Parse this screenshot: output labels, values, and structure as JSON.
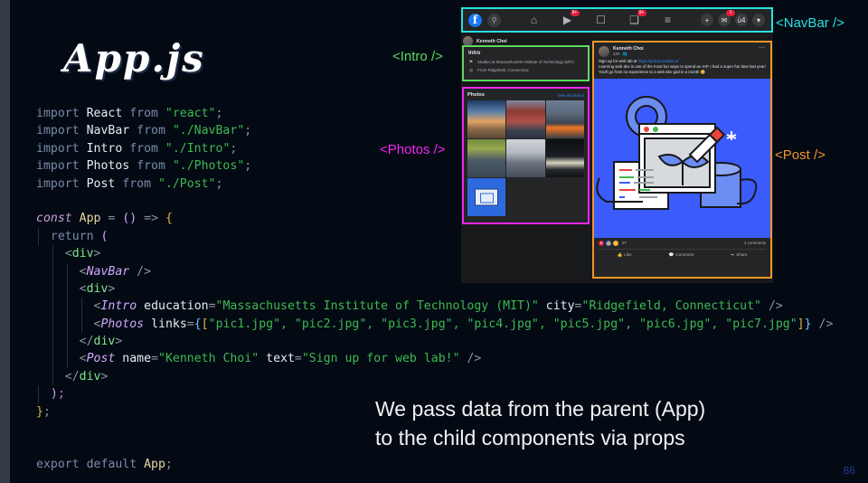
{
  "slide": {
    "title": "App.js",
    "caption_line1": "We pass data from the parent (App)",
    "caption_line2": "to the child components via props",
    "page_number": "86"
  },
  "annotations": {
    "navbar": {
      "label": "<NavBar />",
      "color": "#2ae0e0"
    },
    "intro": {
      "label": "<Intro />",
      "color": "#5cdb5c"
    },
    "photos": {
      "label": "<Photos />",
      "color": "#f026f0"
    },
    "post": {
      "label": "<Post />",
      "color": "#f2952b"
    }
  },
  "code": {
    "lines": [
      {
        "id": "l1",
        "tokens": [
          {
            "t": "import ",
            "c": "kw"
          },
          {
            "t": "React",
            "c": "id"
          },
          {
            "t": " from ",
            "c": "kw"
          },
          {
            "t": "\"react\"",
            "c": "str"
          },
          {
            "t": ";",
            "c": "punc"
          }
        ]
      },
      {
        "id": "l2",
        "tokens": [
          {
            "t": "import ",
            "c": "kw"
          },
          {
            "t": "NavBar",
            "c": "id"
          },
          {
            "t": " from ",
            "c": "kw"
          },
          {
            "t": "\"./NavBar\"",
            "c": "str"
          },
          {
            "t": ";",
            "c": "punc"
          }
        ]
      },
      {
        "id": "l3",
        "tokens": [
          {
            "t": "import ",
            "c": "kw"
          },
          {
            "t": "Intro",
            "c": "id"
          },
          {
            "t": " from ",
            "c": "kw"
          },
          {
            "t": "\"./Intro\"",
            "c": "str"
          },
          {
            "t": ";",
            "c": "punc"
          }
        ]
      },
      {
        "id": "l4",
        "tokens": [
          {
            "t": "import ",
            "c": "kw"
          },
          {
            "t": "Photos",
            "c": "id"
          },
          {
            "t": " from ",
            "c": "kw"
          },
          {
            "t": "\"./Photos\"",
            "c": "str"
          },
          {
            "t": ";",
            "c": "punc"
          }
        ]
      },
      {
        "id": "l5",
        "tokens": [
          {
            "t": "import ",
            "c": "kw"
          },
          {
            "t": "Post",
            "c": "id"
          },
          {
            "t": " from ",
            "c": "kw"
          },
          {
            "t": "\"./Post\"",
            "c": "str"
          },
          {
            "t": ";",
            "c": "punc"
          }
        ]
      },
      {
        "id": "l6",
        "tokens": []
      },
      {
        "id": "l7",
        "tokens": [
          {
            "t": "const ",
            "c": "constkw"
          },
          {
            "t": "App",
            "c": "appname"
          },
          {
            "t": " = ",
            "c": "eq"
          },
          {
            "t": "()",
            "c": "paren"
          },
          {
            "t": " => ",
            "c": "eq"
          },
          {
            "t": "{",
            "c": "brace"
          }
        ]
      },
      {
        "id": "l8",
        "tokens": [
          {
            "t": "  return ",
            "c": "kw"
          },
          {
            "t": "(",
            "c": "paren"
          }
        ]
      },
      {
        "id": "l9",
        "tokens": [
          {
            "t": "    <",
            "c": "punc"
          },
          {
            "t": "div",
            "c": "tag"
          },
          {
            "t": ">",
            "c": "punc"
          }
        ]
      },
      {
        "id": "l10",
        "tokens": [
          {
            "t": "      <",
            "c": "punc"
          },
          {
            "t": "NavBar",
            "c": "comp"
          },
          {
            "t": " />",
            "c": "punc"
          }
        ]
      },
      {
        "id": "l11",
        "tokens": [
          {
            "t": "      <",
            "c": "punc"
          },
          {
            "t": "div",
            "c": "tag"
          },
          {
            "t": ">",
            "c": "punc"
          }
        ]
      },
      {
        "id": "l12",
        "tokens": [
          {
            "t": "        <",
            "c": "punc"
          },
          {
            "t": "Intro",
            "c": "comp"
          },
          {
            "t": " ",
            "c": "punc"
          },
          {
            "t": "education",
            "c": "attr"
          },
          {
            "t": "=",
            "c": "eq"
          },
          {
            "t": "\"Massachusetts Institute of Technology (MIT)\"",
            "c": "str"
          },
          {
            "t": " ",
            "c": "punc"
          },
          {
            "t": "city",
            "c": "attr"
          },
          {
            "t": "=",
            "c": "eq"
          },
          {
            "t": "\"Ridgefield, Connecticut\"",
            "c": "str"
          },
          {
            "t": " />",
            "c": "punc"
          }
        ]
      },
      {
        "id": "l13",
        "tokens": [
          {
            "t": "        <",
            "c": "punc"
          },
          {
            "t": "Photos",
            "c": "comp"
          },
          {
            "t": " ",
            "c": "punc"
          },
          {
            "t": "links",
            "c": "attr"
          },
          {
            "t": "=",
            "c": "eq"
          },
          {
            "t": "{",
            "c": "sq"
          },
          {
            "t": "[",
            "c": "brkt"
          },
          {
            "t": "\"pic1.jpg\", \"pic2.jpg\", \"pic3.jpg\", \"pic4.jpg\", \"pic5.jpg\", \"pic6.jpg\", \"pic7.jpg\"",
            "c": "str"
          },
          {
            "t": "]",
            "c": "brkt"
          },
          {
            "t": "}",
            "c": "sq"
          },
          {
            "t": " />",
            "c": "punc"
          }
        ]
      },
      {
        "id": "l14",
        "tokens": [
          {
            "t": "      </",
            "c": "punc"
          },
          {
            "t": "div",
            "c": "tag"
          },
          {
            "t": ">",
            "c": "punc"
          }
        ]
      },
      {
        "id": "l15",
        "tokens": [
          {
            "t": "      <",
            "c": "punc"
          },
          {
            "t": "Post",
            "c": "comp"
          },
          {
            "t": " ",
            "c": "punc"
          },
          {
            "t": "name",
            "c": "attr"
          },
          {
            "t": "=",
            "c": "eq"
          },
          {
            "t": "\"Kenneth Choi\"",
            "c": "str"
          },
          {
            "t": " ",
            "c": "punc"
          },
          {
            "t": "text",
            "c": "attr"
          },
          {
            "t": "=",
            "c": "eq"
          },
          {
            "t": "\"Sign up for web lab!\"",
            "c": "str"
          },
          {
            "t": " />",
            "c": "punc"
          }
        ]
      },
      {
        "id": "l16",
        "tokens": [
          {
            "t": "    </",
            "c": "punc"
          },
          {
            "t": "div",
            "c": "tag"
          },
          {
            "t": ">",
            "c": "punc"
          }
        ]
      },
      {
        "id": "l17",
        "tokens": [
          {
            "t": "  )",
            "c": "paren"
          },
          {
            "t": ";",
            "c": "semi"
          }
        ]
      },
      {
        "id": "l18",
        "tokens": [
          {
            "t": "}",
            "c": "brace"
          },
          {
            "t": ";",
            "c": "punc"
          }
        ]
      },
      {
        "id": "l19",
        "tokens": []
      },
      {
        "id": "l20",
        "tokens": []
      },
      {
        "id": "l21",
        "tokens": [
          {
            "t": "export default ",
            "c": "kw"
          },
          {
            "t": "App",
            "c": "appname"
          },
          {
            "t": ";",
            "c": "punc"
          }
        ]
      }
    ]
  },
  "facebook": {
    "navbar": {
      "logo": "f",
      "search_icon": "search-icon",
      "center_icons": [
        {
          "name": "home-icon",
          "glyph": "⌂",
          "badge": ""
        },
        {
          "name": "video-icon",
          "glyph": "▶",
          "badge": "9+"
        },
        {
          "name": "marketplace-icon",
          "glyph": "☐",
          "badge": ""
        },
        {
          "name": "groups-icon",
          "glyph": "❑",
          "badge": "9+"
        },
        {
          "name": "menu-icon",
          "glyph": "≡",
          "badge": ""
        }
      ],
      "right_icons": [
        {
          "name": "create-icon",
          "glyph": "+",
          "badge": ""
        },
        {
          "name": "messenger-icon",
          "glyph": "✉",
          "badge": "1"
        },
        {
          "name": "notifications-icon",
          "glyph": "ὑ4",
          "badge": ""
        },
        {
          "name": "account-icon",
          "glyph": "▾",
          "badge": ""
        }
      ]
    },
    "profile_name": "Kenneth Choi",
    "intro": {
      "heading": "Intro",
      "rows": [
        {
          "icon": "graduation-cap-icon",
          "glyph": "⚑",
          "text": "Studies at Massachusetts Institute of Technology (MIT)"
        },
        {
          "icon": "location-pin-icon",
          "glyph": "◎",
          "text": "From Ridgefield, Connecticut"
        }
      ]
    },
    "photos": {
      "heading": "Photos",
      "see_all": "See all photos",
      "items": [
        {
          "name": "pic1.jpg"
        },
        {
          "name": "pic2.jpg"
        },
        {
          "name": "pic3.jpg"
        },
        {
          "name": "pic4.jpg"
        },
        {
          "name": "pic5.jpg"
        },
        {
          "name": "pic6.jpg"
        },
        {
          "name": "pic7.jpg"
        }
      ]
    },
    "post": {
      "author": "Kenneth Choi",
      "meta": "22h · 🌐",
      "more_glyph": "⋯",
      "text_line1_pre": "Sign up for web lab at ",
      "text_link": "https://portal.weblab.is/",
      "text_line2": "Learning web dev is one of the most fun ways to spend an IAP. I had a super fun time last year!",
      "text_line3": "You'll go from no experience to a web dev god in a month 😊",
      "reactions_count": "27",
      "comments_count": "4 comments",
      "actions": [
        {
          "name": "like-action",
          "glyph": "👍",
          "label": "Like"
        },
        {
          "name": "comment-action",
          "glyph": "💬",
          "label": "Comment"
        },
        {
          "name": "share-action",
          "glyph": "➦",
          "label": "Share"
        }
      ]
    }
  }
}
